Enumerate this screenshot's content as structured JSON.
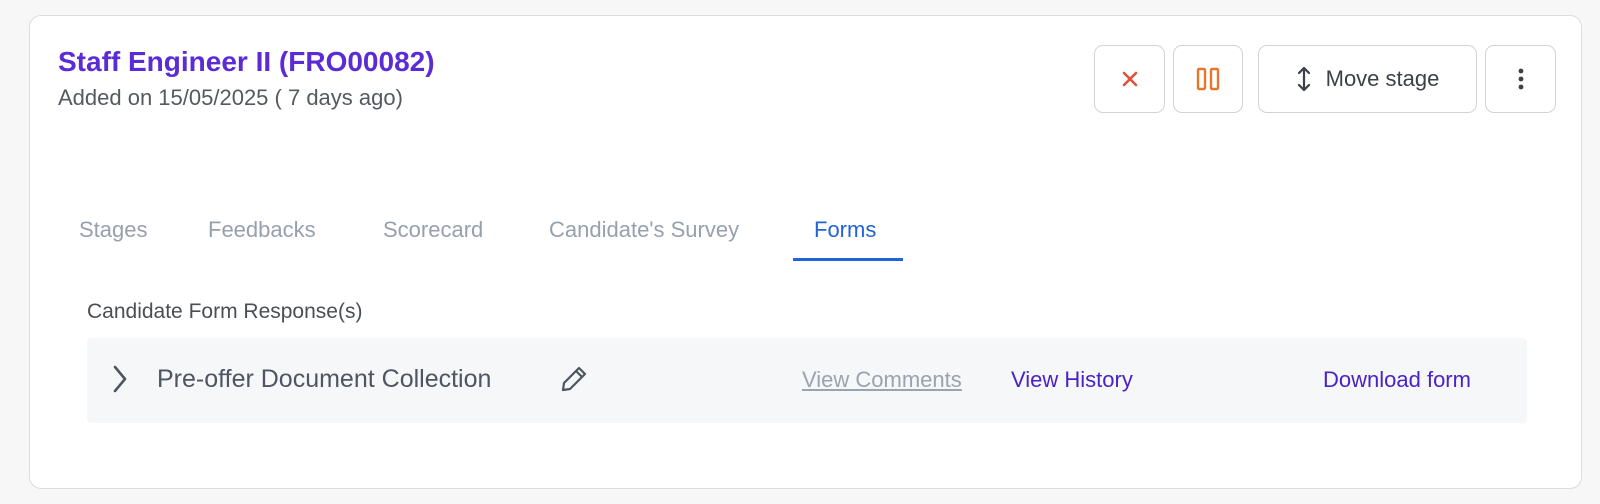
{
  "header": {
    "title": "Staff Engineer II (FRO00082)",
    "added_on": "Added on 15/05/2025 ( 7 days ago)"
  },
  "actions": {
    "reject_icon": "close-icon",
    "hold_icon": "pause-icon",
    "move_stage_label": "Move stage",
    "move_stage_icon": "vertical-arrows-icon",
    "more_icon": "more-vertical-icon"
  },
  "tabs": [
    {
      "label": "Stages",
      "active": false
    },
    {
      "label": "Feedbacks",
      "active": false
    },
    {
      "label": "Scorecard",
      "active": false
    },
    {
      "label": "Candidate's Survey",
      "active": false
    },
    {
      "label": "Forms",
      "active": true
    }
  ],
  "forms_section": {
    "heading": "Candidate Form Response(s)",
    "forms": [
      {
        "name": "Pre-offer Document Collection",
        "view_comments": "View Comments",
        "view_history": "View History",
        "download": "Download form"
      }
    ]
  },
  "colors": {
    "title": "#5b2bd6",
    "reject": "#e0513a",
    "hold": "#e8772e",
    "active_tab": "#2163d8",
    "link": "#4a23c7",
    "muted_link": "#9aa3b0"
  }
}
